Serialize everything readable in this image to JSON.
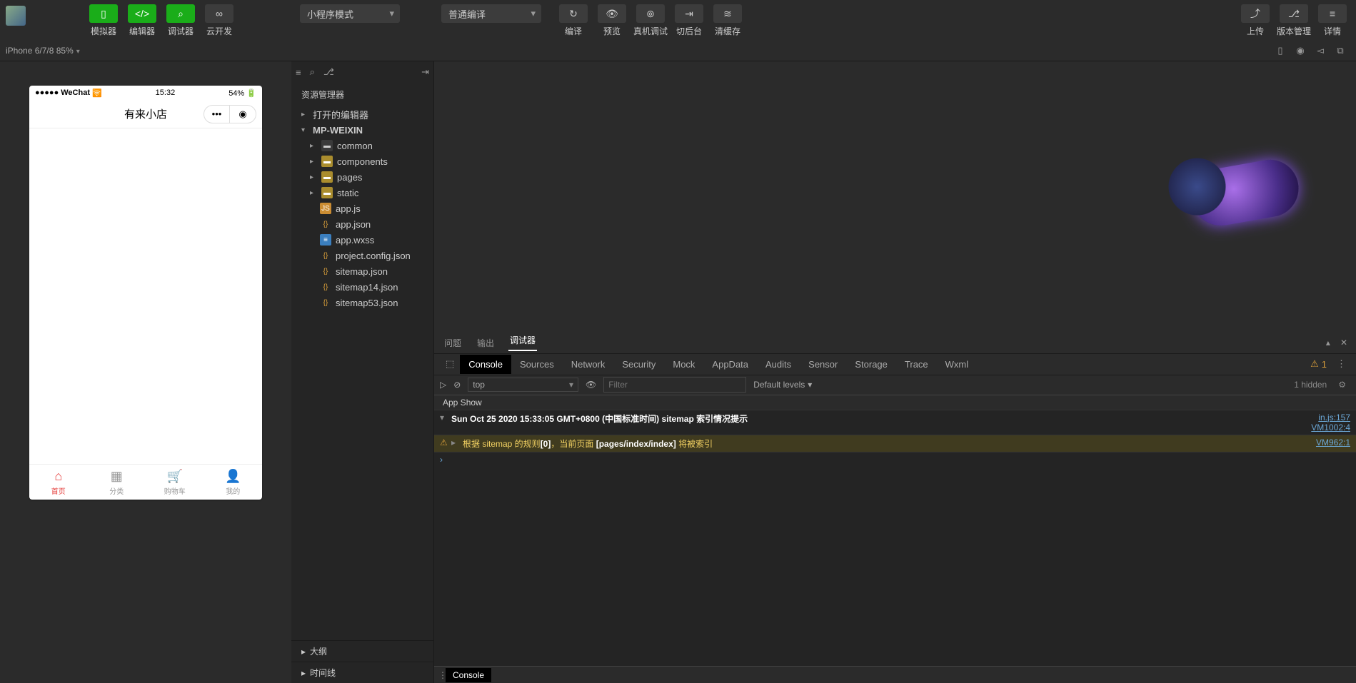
{
  "toolbar": {
    "simulator": "模拟器",
    "editor": "编辑器",
    "debugger": "调试器",
    "cloud": "云开发",
    "mode_select": "小程序模式",
    "compile_select": "普通编译",
    "compile": "编译",
    "preview": "预览",
    "real_debug": "真机调试",
    "background": "切后台",
    "clear_cache": "清缓存",
    "upload": "上传",
    "version": "版本管理",
    "detail": "详情"
  },
  "subbar": {
    "device": "iPhone 6/7/8 85%"
  },
  "phone": {
    "carrier": "WeChat",
    "time": "15:32",
    "battery": "54%",
    "app_title": "有来小店",
    "tabs": {
      "home": "首页",
      "category": "分类",
      "cart": "购物车",
      "me": "我的"
    }
  },
  "explorer": {
    "title": "资源管理器",
    "open_editors": "打开的编辑器",
    "project": "MP-WEIXIN",
    "folders": {
      "common": "common",
      "components": "components",
      "pages": "pages",
      "static": "static"
    },
    "files": {
      "app_js": "app.js",
      "app_json": "app.json",
      "app_wxss": "app.wxss",
      "project_config": "project.config.json",
      "sitemap": "sitemap.json",
      "sitemap14": "sitemap14.json",
      "sitemap53": "sitemap53.json"
    },
    "outline": "大纲",
    "timeline": "时间线"
  },
  "debug": {
    "tabs": {
      "problems": "问题",
      "output": "输出",
      "debugger": "调试器"
    },
    "devtools_tabs": {
      "console": "Console",
      "sources": "Sources",
      "network": "Network",
      "security": "Security",
      "mock": "Mock",
      "appdata": "AppData",
      "audits": "Audits",
      "sensor": "Sensor",
      "storage": "Storage",
      "trace": "Trace",
      "wxml": "Wxml"
    },
    "warn_count": "1",
    "context": "top",
    "filter_placeholder": "Filter",
    "levels": "Default levels",
    "hidden": "1 hidden",
    "app_show": "App   Show",
    "log1_text": "Sun Oct 25 2020 15:33:05 GMT+0800 (中国标准时间) sitemap 索引情况提示",
    "log1_src_a": "in.js:157",
    "log1_src_b": "VM1002:4",
    "log2_pre": "根据 sitemap 的规则",
    "log2_idx": "[0]",
    "log2_mid": "，当前页面",
    "log2_page": "[pages/index/index]",
    "log2_post": " 将被索引",
    "log2_src": "VM962:1",
    "drawer": "Console"
  }
}
